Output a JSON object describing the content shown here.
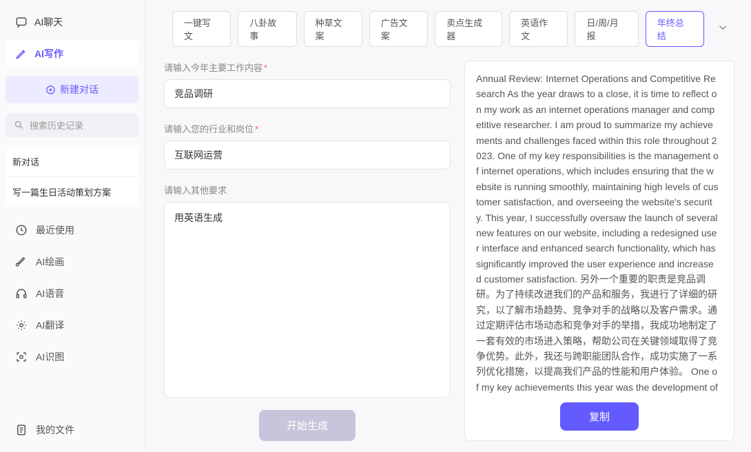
{
  "sidebar": {
    "nav": [
      {
        "label": "AI聊天"
      },
      {
        "label": "AI写作"
      }
    ],
    "new_chat": "新建对话",
    "search_placeholder": "搜索历史记录",
    "history": [
      "新对话",
      "写一篇生日活动策划方案"
    ],
    "tools": [
      {
        "label": "最近使用"
      },
      {
        "label": "AI绘画"
      },
      {
        "label": "AI语音"
      },
      {
        "label": "AI翻译"
      },
      {
        "label": "AI识图"
      }
    ],
    "my_files": "我的文件"
  },
  "tabs": [
    "一键写文",
    "八卦故事",
    "种草文案",
    "广告文案",
    "卖点生成器",
    "英语作文",
    "日/周/月报",
    "年终总结"
  ],
  "form": {
    "label_work": "请输入今年主要工作内容",
    "value_work": "竞品调研",
    "label_role": "请输入您的行业和岗位",
    "value_role": "互联网运营",
    "label_extra": "请输入其他要求",
    "value_extra": "用英语生成",
    "generate": "开始生成"
  },
  "output": {
    "text": "Annual Review: Internet Operations and Competitive Research As the year draws to a close, it is time to reflect on my work as an internet operations manager and competitive researcher. I am proud to summarize my achievements and challenges faced within this role throughout 2023. One of my key responsibilities is the management of internet operations, which includes ensuring that the website is running smoothly, maintaining high levels of customer satisfaction, and overseeing the website's security. This year, I successfully oversaw the launch of several new features on our website, including a redesigned user interface and enhanced search functionality, which has significantly improved the user experience and increased customer satisfaction. 另外一个重要的职责是竞品调研。为了持续改进我们的产品和服务，我进行了详细的研究，以了解市场趋势、竞争对手的战略以及客户需求。通过定期评估市场动态和竞争对手的举措，我成功地制定了一套有效的市场进入策略，帮助公司在关键领域取得了竞争优势。此外，我还与跨职能团队合作，成功实施了一系列优化措施，以提高我们产品的性能和用户体验。   One of my key achievements this year was the development of a comprehensive c",
    "copy": "复制"
  }
}
